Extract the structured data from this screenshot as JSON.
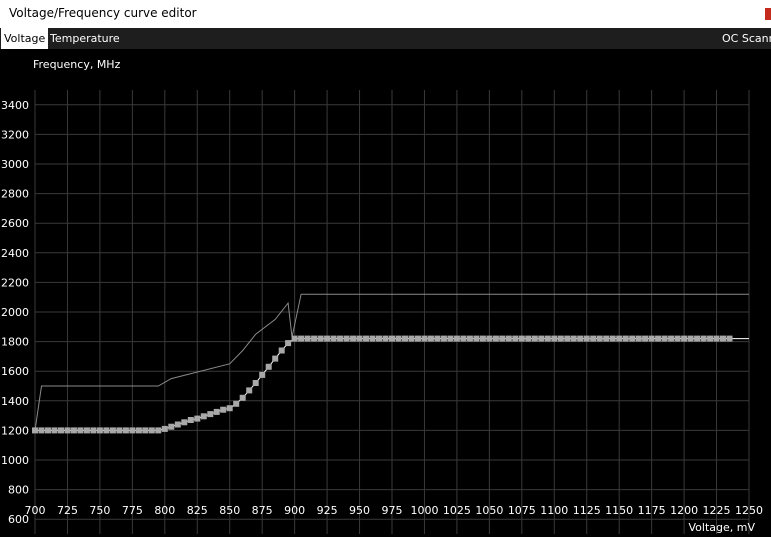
{
  "window": {
    "title": "Voltage/Frequency curve editor"
  },
  "tabs": {
    "voltage": "Voltage",
    "temperature": "Temperature",
    "oc_scanner": "OC Scann"
  },
  "colors": {
    "background": "#000000",
    "grid": "#3a3a3a",
    "default_curve": "#8a8a8a",
    "edited_curve": "#ffffff",
    "point_marker": "#a8a8a8"
  },
  "chart_data": {
    "type": "line",
    "xlabel": "Voltage, mV",
    "ylabel": "Frequency, MHz",
    "xlim": [
      700,
      1250
    ],
    "ylim": [
      500,
      3500
    ],
    "x_ticks": [
      700,
      725,
      750,
      775,
      800,
      825,
      850,
      875,
      900,
      925,
      950,
      975,
      1000,
      1025,
      1050,
      1075,
      1100,
      1125,
      1150,
      1175,
      1200,
      1225,
      1250
    ],
    "y_ticks": [
      600,
      800,
      1000,
      1200,
      1400,
      1600,
      1800,
      2000,
      2200,
      2400,
      2600,
      2800,
      3000,
      3200,
      3400
    ],
    "grid": true,
    "series": [
      {
        "values_x": [
          700,
          705,
          795,
          805,
          850,
          860,
          870,
          885,
          895,
          898,
          905,
          1250
        ],
        "values_y": [
          1200,
          1500,
          1500,
          1550,
          1650,
          1740,
          1850,
          1950,
          2060,
          1830,
          2120,
          2120
        ]
      },
      {
        "values_x": [
          700,
          795,
          800,
          805,
          810,
          815,
          820,
          825,
          830,
          835,
          840,
          845,
          850,
          855,
          860,
          865,
          870,
          875,
          880,
          885,
          890,
          895,
          900,
          1237,
          1250
        ],
        "values_y": [
          1200,
          1200,
          1210,
          1225,
          1240,
          1255,
          1270,
          1280,
          1295,
          1310,
          1325,
          1340,
          1350,
          1380,
          1420,
          1470,
          1520,
          1575,
          1630,
          1685,
          1740,
          1790,
          1820,
          1820,
          1820
        ],
        "markers": [
          700,
          705,
          710,
          715,
          720,
          725,
          730,
          735,
          740,
          745,
          750,
          755,
          760,
          765,
          770,
          775,
          780,
          785,
          790,
          795,
          800,
          805,
          810,
          815,
          820,
          825,
          830,
          835,
          840,
          845,
          850,
          855,
          860,
          865,
          870,
          875,
          880,
          885,
          890,
          895,
          900,
          905,
          910,
          915,
          920,
          925,
          930,
          935,
          940,
          945,
          950,
          955,
          960,
          965,
          970,
          975,
          980,
          985,
          990,
          995,
          1000,
          1005,
          1010,
          1015,
          1020,
          1025,
          1030,
          1035,
          1040,
          1045,
          1050,
          1055,
          1060,
          1065,
          1070,
          1075,
          1080,
          1085,
          1090,
          1095,
          1100,
          1105,
          1110,
          1115,
          1120,
          1125,
          1130,
          1135,
          1140,
          1145,
          1150,
          1155,
          1160,
          1165,
          1170,
          1175,
          1180,
          1185,
          1190,
          1195,
          1200,
          1205,
          1210,
          1215,
          1220,
          1225,
          1230,
          1235
        ]
      }
    ]
  }
}
